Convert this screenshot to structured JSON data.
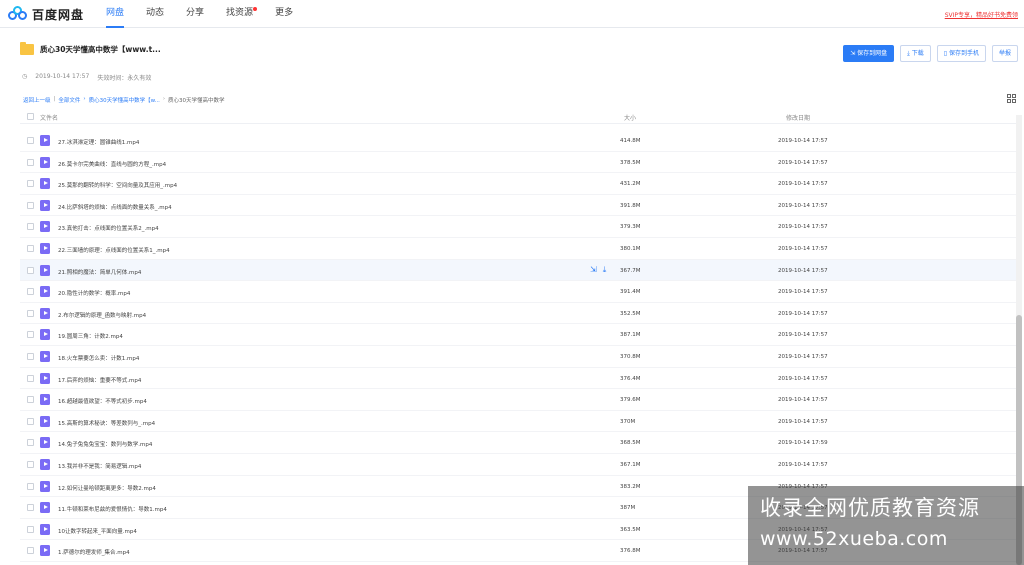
{
  "app": {
    "logo_text": "百度网盘"
  },
  "nav": [
    {
      "label": "网盘"
    },
    {
      "label": "动态"
    },
    {
      "label": "分享"
    },
    {
      "label": "找资源"
    },
    {
      "label": "更多"
    }
  ],
  "svip_link": "SVIP专享，精品好书免费领",
  "folder": {
    "title": "质心30天学懂高中数学【www.t...",
    "date": "2019-10-14 17:57",
    "expire_label": "失效时间：永久有效"
  },
  "actions": {
    "save": "保存到网盘",
    "download": "下载",
    "save_phone": "保存到手机",
    "report": "举报"
  },
  "breadcrumb": {
    "back": "返回上一级",
    "sep": "|",
    "all": "全部文件",
    "parent": "质心30天学懂高中数学【w...",
    "current": "质心30天学懂高中数学"
  },
  "table": {
    "col_name": "文件名",
    "col_size": "大小",
    "col_date": "修改日期"
  },
  "files": [
    {
      "name": "27.冰淇淋定理：圆锥曲线1.mp4",
      "size": "414.8M",
      "date": "2019-10-14 17:57"
    },
    {
      "name": "26.莫卡尔完美曲线：直线与圆的方程_.mp4",
      "size": "378.5M",
      "date": "2019-10-14 17:57"
    },
    {
      "name": "25.莫那的翻转的科学：空间向量及其应用_.mp4",
      "size": "431.2M",
      "date": "2019-10-14 17:57"
    },
    {
      "name": "24.比萨斜塔的烦恼：点线面的数量关系_.mp4",
      "size": "391.8M",
      "date": "2019-10-14 17:57"
    },
    {
      "name": "23.真他打击：点线面的位置关系2_.mp4",
      "size": "379.3M",
      "date": "2019-10-14 17:57"
    },
    {
      "name": "22.三面墙的原理：点线面的位置关系1_.mp4",
      "size": "380.1M",
      "date": "2019-10-14 17:57"
    },
    {
      "name": "21.照相的魔法：简单几何体.mp4",
      "size": "367.7M",
      "date": "2019-10-14 17:57"
    },
    {
      "name": "20.隐性计的数学：概率.mp4",
      "size": "391.4M",
      "date": "2019-10-14 17:57"
    },
    {
      "name": "2.布尔逻辑的原理_函数与映射.mp4",
      "size": "352.5M",
      "date": "2019-10-14 17:57"
    },
    {
      "name": "19.圆周三角：计数2.mp4",
      "size": "387.1M",
      "date": "2019-10-14 17:57"
    },
    {
      "name": "18.火车票要怎么卖：计数1.mp4",
      "size": "370.8M",
      "date": "2019-10-14 17:57"
    },
    {
      "name": "17.后弈的烦恼：重要不等式.mp4",
      "size": "376.4M",
      "date": "2019-10-14 17:57"
    },
    {
      "name": "16.超越最值欲望：不等式初步.mp4",
      "size": "379.6M",
      "date": "2019-10-14 17:57"
    },
    {
      "name": "15.高斯的算术秘诀：等差数列与_.mp4",
      "size": "370M",
      "date": "2019-10-14 17:57"
    },
    {
      "name": "14.兔子兔兔兔宝宝：数列与数学.mp4",
      "size": "368.5M",
      "date": "2019-10-14 17:59"
    },
    {
      "name": "13.我并非不是我：简易逻辑.mp4",
      "size": "367.1M",
      "date": "2019-10-14 17:57"
    },
    {
      "name": "12.如何让曼哈顿距离更多：导数2.mp4",
      "size": "383.2M",
      "date": "2019-10-14 17:57"
    },
    {
      "name": "11.牛顿和莱布尼兹的爱恨情仇：导数1.mp4",
      "size": "387M",
      "date": "2019-10-14 17:57"
    },
    {
      "name": "10让数字转起来_平面向量.mp4",
      "size": "363.5M",
      "date": "2019-10-14 17:57"
    },
    {
      "name": "1.萨德尔的理发师_集合.mp4",
      "size": "376.8M",
      "date": "2019-10-14 17:57"
    }
  ],
  "watermark": {
    "line1": "收录全网优质教育资源",
    "line2": "www.52xueba.com"
  },
  "colors": {
    "accent": "#2b7cf6",
    "video_icon": "#7a6bf5",
    "folder": "#f9c443"
  }
}
